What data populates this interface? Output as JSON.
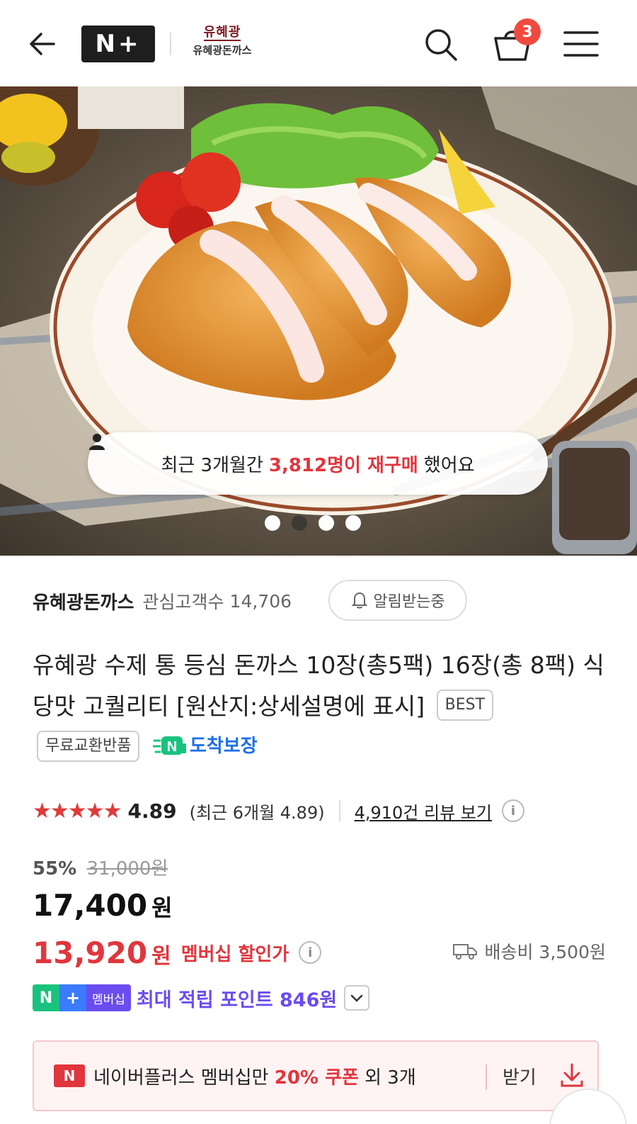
{
  "header": {
    "logo_text": "N+",
    "brand_mark": "유혜광",
    "brand_name": "유혜광돈까스",
    "cart_count": "3"
  },
  "hero": {
    "repurchase_prefix": "최근 3개월간",
    "repurchase_highlight": "3,812명이 재구매",
    "repurchase_suffix": "했어요",
    "slide_total": 4,
    "slide_active": 2
  },
  "seller": {
    "name": "유혜광돈까스",
    "follower_label": "관심고객수",
    "follower_count": "14,706",
    "notify_label": "알림받는중"
  },
  "product": {
    "title": "유혜광 수제 통 등심 돈까스 10장(총5팩) 16장(총 8팩) 식당맛 고퀄리티 [원산지:상세설명에 표시]",
    "tags": [
      "BEST",
      "무료교환반품"
    ],
    "guarantee_label": "도착보장"
  },
  "rating": {
    "stars": "★★★★★",
    "score": "4.89",
    "recent": "(최근 6개월 4.89)",
    "review_link": "4,910건 리뷰 보기"
  },
  "price": {
    "discount_rate": "55%",
    "original": "31,000원",
    "sale": "17,400",
    "won": "원",
    "member": "13,920",
    "member_label": "멤버십 할인가",
    "shipping": "배송비 3,500원"
  },
  "points": {
    "badge_n": "N",
    "badge_plus": "+",
    "badge_member": "멤버십",
    "text": "최대 적립 포인트 846원"
  },
  "coupon": {
    "icon_text": "N",
    "text_before": "네이버플러스 멤버십만",
    "text_highlight": "20% 쿠폰",
    "text_after": "외 3개",
    "get_label": "받기"
  },
  "colors": {
    "accent_red": "#e0363d",
    "member_purple": "#6a4cf0",
    "badge_red": "#f04a3f"
  }
}
